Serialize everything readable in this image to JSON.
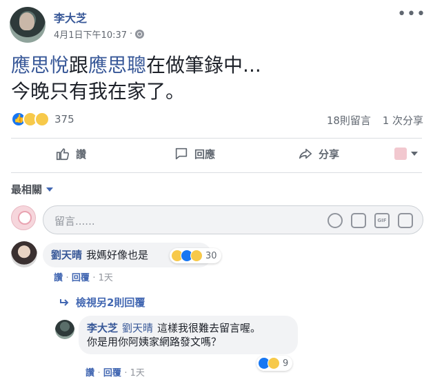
{
  "post": {
    "author": "李大芝",
    "timestamp": "4月1日下午10:37",
    "separator": "·",
    "text_tag1": "應思悅",
    "text_mid": "跟",
    "text_tag2": "應思聰",
    "text_rest_line1": "在做筆錄中...",
    "text_line2": "今晚只有我在家了。",
    "reaction_count": "375",
    "comments_count": "18則留言",
    "shares_count": "1 次分享"
  },
  "actions": {
    "like": "讚",
    "comment": "回應",
    "share": "分享"
  },
  "comments_section": {
    "sort_label": "最相關",
    "input_placeholder": "留言......",
    "comments": [
      {
        "author": "劉天晴",
        "text": "我媽好像也是",
        "reaction_count": "30",
        "like_label": "讚",
        "reply_label": "回覆",
        "time": "1天"
      }
    ],
    "view_more_replies": "檢視另2則回覆",
    "reply": {
      "author": "李大芝",
      "mention": "劉天晴",
      "text_line1": "這樣我很難去留言喔。",
      "text_line2": "你是用你阿姨家網路發文嗎？",
      "reaction_count": "9",
      "like_label": "讚",
      "reply_label": "回覆",
      "time": "1天"
    }
  },
  "colors": {
    "link": "#385898",
    "accent": "#4267b2",
    "muted": "#606770",
    "bubble": "#f2f3f5"
  },
  "icons": [
    "more-icon",
    "globe-icon",
    "like-icon",
    "comment-icon",
    "share-icon",
    "emoji-icon",
    "camera-icon",
    "gif-icon",
    "sticker-icon",
    "reply-arrow-icon"
  ]
}
